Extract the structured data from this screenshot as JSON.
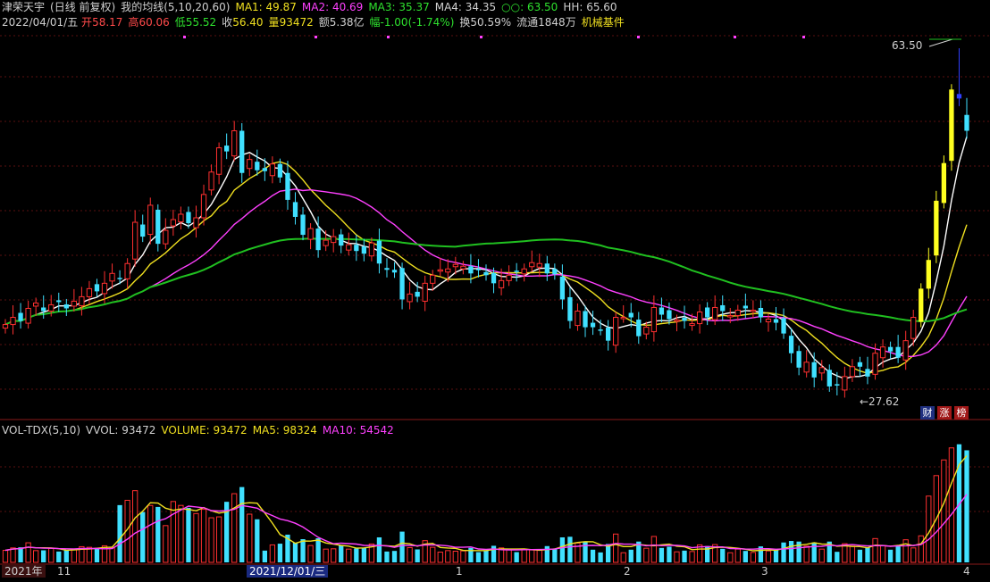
{
  "header": {
    "stock_name": "津荣天宇",
    "period": "(日线 前复权)",
    "indicator": "我的均线(5,10,20,60)",
    "ma1": "MA1: 49.87",
    "ma2": "MA2: 40.69",
    "ma3": "MA3: 35.37",
    "ma4": "MA4: 34.35",
    "ma5": "○○: 63.50",
    "hh": "HH: 65.60",
    "date": "2022/04/01/五",
    "open_label": "开",
    "open": "58.17",
    "high_label": "高",
    "high": "60.06",
    "low_label": "低",
    "low": "55.52",
    "close_label": "收",
    "close": "56.40",
    "vol_label": "量",
    "vol": "93472",
    "amount_label": "额",
    "amount": "5.38亿",
    "change_label": "幅",
    "change": "-1.00(-1.74%)",
    "turnover": "换50.59%",
    "float": "流通1848万",
    "sector": "机械基件"
  },
  "volume_header": {
    "name": "VOL-TDX(5,10)",
    "vvol": "VVOL: 93472",
    "volume": "VOLUME: 93472",
    "ma5": "MA5: 98324",
    "ma10": "MA10: 54542"
  },
  "annotations": {
    "high_label": "63.50",
    "low_label": "←27.62"
  },
  "buttons": {
    "cai": "财",
    "zhang": "涨",
    "bang": "榜"
  },
  "x_axis": {
    "start": "2021年",
    "cursor": "2021/12/01/三",
    "ticks": [
      "11",
      "1",
      "2",
      "3",
      "4"
    ]
  },
  "colors": {
    "up": "#ff3030",
    "down": "#40e0ff",
    "ma5": "#ffffff",
    "ma10": "#f0e020",
    "ma20": "#ff40ff",
    "ma60": "#20c020",
    "special_down": "#3040ff",
    "special_up": "#ffff20"
  },
  "chart_data": {
    "type": "candlestick",
    "price_range": [
      26,
      67
    ],
    "series_closes": [
      34.8,
      35.6,
      35.2,
      36.6,
      37.2,
      36.3,
      37.0,
      37.3,
      36.6,
      37.4,
      37.9,
      38.8,
      38.5,
      39.4,
      40.5,
      39.9,
      41.6,
      46.2,
      44.6,
      48.1,
      43.8,
      45.3,
      46.5,
      47.1,
      46.1,
      46.7,
      49.3,
      51.8,
      54.5,
      54.1,
      56.4,
      51.7,
      53.2,
      52.0,
      51.9,
      52.7,
      51.2,
      48.7,
      46.8,
      44.8,
      45.5,
      43.1,
      44.2,
      44.6,
      43.6,
      43.7,
      43.0,
      42.7,
      43.9,
      41.6,
      40.9,
      40.6,
      37.6,
      38.2,
      37.9,
      39.4,
      40.3,
      40.9,
      41.0,
      41.5,
      41.3,
      40.5,
      40.9,
      40.3,
      39.4,
      39.7,
      40.3,
      40.7,
      41.0,
      41.7,
      41.6,
      40.5,
      40.4,
      37.6,
      35.2,
      36.3,
      34.5,
      34.5,
      34.2,
      33.0,
      35.6,
      35.6,
      35.6,
      33.5,
      34.5,
      36.7,
      35.9,
      35.4,
      35.3,
      35.2,
      34.9,
      36.2,
      35.6,
      36.7,
      36.3,
      35.8,
      36.4,
      36.6,
      36.4,
      35.6,
      35.4,
      35.0,
      33.8,
      31.6,
      30.0,
      30.6,
      28.9,
      30.0,
      27.9,
      28.0,
      29.0,
      30.1,
      30.1,
      29.0,
      31.6,
      32.3,
      31.8,
      31.1,
      33.0,
      35.6,
      38.8,
      42.0,
      48.6,
      52.8,
      61.0,
      60.0,
      56.4
    ],
    "volumes": [],
    "ma_periods": [
      5,
      10,
      20,
      60
    ],
    "annotations": {
      "max": 63.5,
      "min": 27.62
    }
  }
}
